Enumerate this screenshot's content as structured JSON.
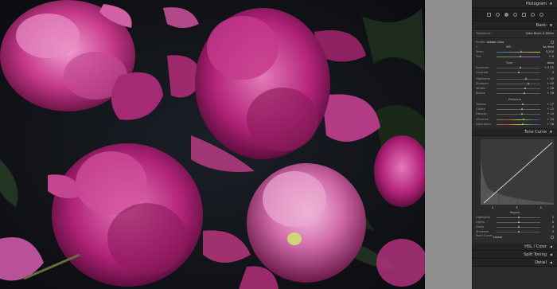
{
  "panel": {
    "histogram": {
      "title": "Histogram"
    },
    "basic": {
      "title": "Basic",
      "treatment_label": "Treatment :",
      "treatment_color": "Color",
      "treatment_bw": "Black & White",
      "profile_label": "Profile :",
      "profile_value": "Adobe Color",
      "wb_label": "WB :",
      "wb_value": "As Shot",
      "temp_label": "Temp",
      "temp_value": "5,200",
      "tint_label": "Tint",
      "tint_value": "+ 6",
      "tone_label": "Tone",
      "tone_auto": "Auto",
      "exposure_label": "Exposure",
      "exposure_value": "+ 0.20",
      "contrast_label": "Contrast",
      "contrast_value": "0",
      "highlights_label": "Highlights",
      "highlights_value": "+ 32",
      "shadows_label": "Shadows",
      "shadows_value": "+ 45",
      "whites_label": "Whites",
      "whites_value": "+ 28",
      "blacks_label": "Blacks",
      "blacks_value": "+ 26",
      "presence_label": "Presence",
      "texture_label": "Texture",
      "texture_value": "+ 17",
      "clarity_label": "Clarity",
      "clarity_value": "+ 12",
      "dehaze_label": "Dehaze",
      "dehaze_value": "+ 14",
      "vibrance_label": "Vibrance",
      "vibrance_value": "+ 20",
      "saturation_label": "Saturation",
      "saturation_value": "+ 16"
    },
    "tone_curve": {
      "title": "Tone Curve",
      "region_label": "Region",
      "highlights_label": "Highlights",
      "highlights_value": "0",
      "lights_label": "Lights",
      "lights_value": "0",
      "darks_label": "Darks",
      "darks_value": "0",
      "shadows_label": "Shadows",
      "shadows_value": "0",
      "point_curve_label": "Point Curve :",
      "point_curve_value": "Linear"
    },
    "hsl": {
      "title": "HSL / Color"
    },
    "split_toning": {
      "title": "Split Toning"
    },
    "detail": {
      "title": "Detail"
    }
  },
  "colors": {
    "panel_bg": "#2b2b2b",
    "header_bg": "#232323",
    "gap_bg": "#8f8f8f",
    "photo_bg": "#101114",
    "peony_magenta": "#b0226e",
    "peony_pink": "#d65aa3"
  }
}
